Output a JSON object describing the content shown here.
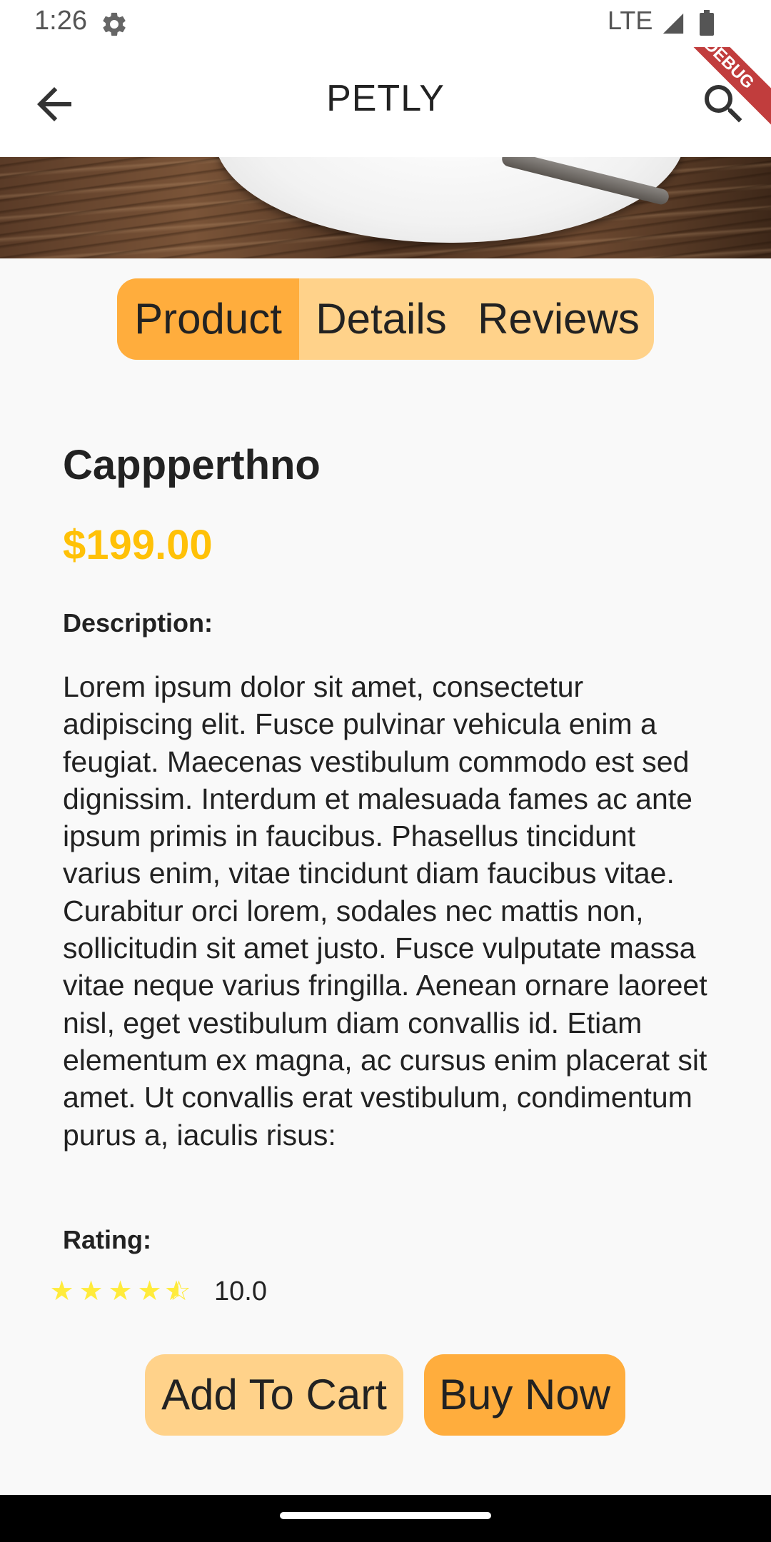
{
  "status_bar": {
    "time": "1:26",
    "network": "LTE"
  },
  "app_bar": {
    "title": "PETLY",
    "debug_banner": "DEBUG"
  },
  "tabs": [
    {
      "label": "Product",
      "selected": true
    },
    {
      "label": "Details",
      "selected": false
    },
    {
      "label": "Reviews",
      "selected": false
    }
  ],
  "product": {
    "name": "Cappperthno",
    "price": "$199.00",
    "description_label": "Description:",
    "description": "Lorem ipsum dolor sit amet, consectetur adipiscing elit. Fusce pulvinar vehicula enim a feugiat. Maecenas vestibulum commodo est sed dignissim. Interdum et malesuada fames ac ante ipsum primis in faucibus. Phasellus tincidunt varius enim, vitae tincidunt diam faucibus vitae. Curabitur orci lorem, sodales nec mattis non, sollicitudin sit amet justo. Fusce vulputate massa vitae neque varius fringilla. Aenean ornare laoreet nisl, eget vestibulum diam convallis id. Etiam elementum ex magna, ac cursus enim placerat sit amet. Ut convallis erat vestibulum, condimentum purus a, iaculis risus:",
    "rating_label": "Rating:",
    "rating_value": "10.0",
    "stars_filled": 4.5,
    "stars_total": 5
  },
  "actions": {
    "add_to_cart": "Add To Cart",
    "buy_now": "Buy Now"
  },
  "colors": {
    "accent_dark": "#ffad3d",
    "accent_light": "#ffd28a",
    "price": "#ffc107",
    "star": "#ffeb3b"
  },
  "icons": [
    "settings-icon",
    "signal-icon",
    "battery-icon",
    "back-arrow-icon",
    "search-icon",
    "star-icon",
    "star-half-icon"
  ]
}
